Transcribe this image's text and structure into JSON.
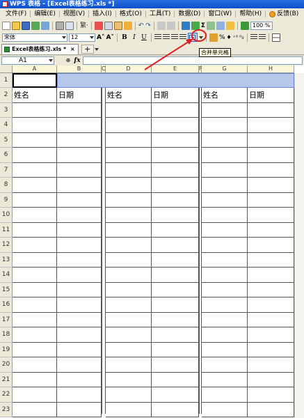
{
  "window": {
    "title": "WPS 表格 - [Excel表格练习.xls *]"
  },
  "menu": [
    "文件(F)",
    "编辑(E)",
    "视图(V)",
    "插入(I)",
    "格式(O)",
    "工具(T)",
    "数据(D)",
    "窗口(W)",
    "帮助(H)"
  ],
  "feedback_label": "反馈(B)",
  "toolbar": {
    "zoom": "100 %",
    "font_name": "宋体",
    "font_size": "12",
    "bold": "B",
    "italic": "I",
    "underline": "U",
    "percent": "%",
    "sigma": "Σ",
    "undo_redo": "↶ ↷"
  },
  "tooltip": "合并单元格",
  "tab": {
    "label": "Excel表格练习.xls *",
    "close": "×",
    "add": "+"
  },
  "formula_bar": {
    "cell_ref": "A1",
    "fx": "fx",
    "content": ""
  },
  "columns": [
    "A",
    "B",
    "C",
    "D",
    "E",
    "F",
    "G",
    "H"
  ],
  "rows": [
    "1",
    "2",
    "3",
    "4",
    "5",
    "6",
    "7",
    "8",
    "9",
    "10",
    "11",
    "12",
    "13",
    "14",
    "15",
    "16",
    "17",
    "18",
    "19",
    "20",
    "21",
    "22",
    "23"
  ],
  "headers": {
    "name": "姓名",
    "date": "日期"
  },
  "colors": {
    "selection": "#b6c7ec",
    "annotation": "#e02020",
    "header_bg": "#fbf5d9"
  }
}
